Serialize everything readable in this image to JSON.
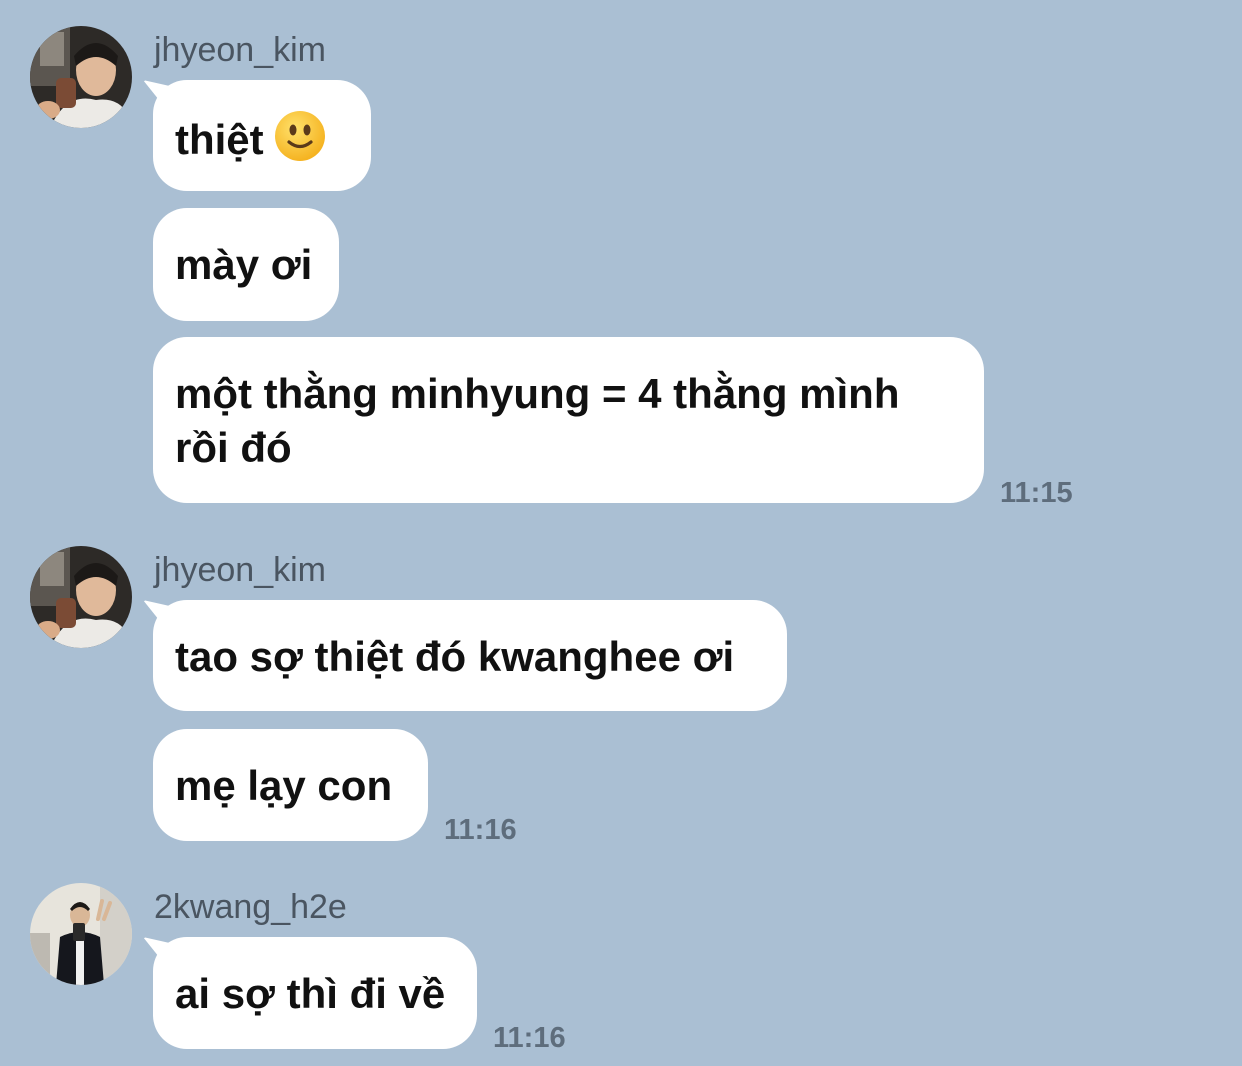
{
  "messages": [
    {
      "sender": "jhyeon_kim",
      "avatar": "avatar-jhyeon-kim",
      "bubbles": [
        {
          "text": "thiệt",
          "emoji": "slightly-smiling-face-icon"
        },
        {
          "text": "mày ơi"
        },
        {
          "line1": "một thằng minhyung = 4 thằng mình",
          "line2": "rồi đó"
        }
      ],
      "time": "11:15"
    },
    {
      "sender": "jhyeon_kim",
      "avatar": "avatar-jhyeon-kim",
      "bubbles": [
        {
          "text": "tao sợ thiệt đó kwanghee ơi"
        },
        {
          "text": "mẹ lạy con"
        }
      ],
      "time": "11:16"
    },
    {
      "sender": "2kwang_h2e",
      "avatar": "avatar-2kwang-h2e",
      "bubbles": [
        {
          "text": "ai sợ thì đi về"
        }
      ],
      "time": "11:16"
    }
  ],
  "colors": {
    "background": "#aabfd3",
    "bubble": "#ffffff",
    "username": "#4a5561",
    "timestamp": "#5e6d7c"
  }
}
